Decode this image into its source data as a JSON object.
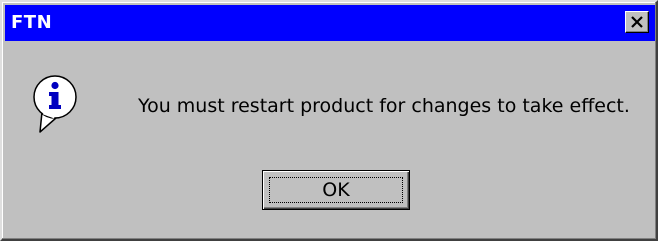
{
  "window": {
    "title": "FTN"
  },
  "dialog": {
    "message": "You must restart product for changes to take effect.",
    "icon": "info-icon",
    "ok_label": "OK"
  },
  "colors": {
    "titlebar": "#0000ff",
    "face": "#c0c0c0",
    "title_text": "#ffffff"
  }
}
